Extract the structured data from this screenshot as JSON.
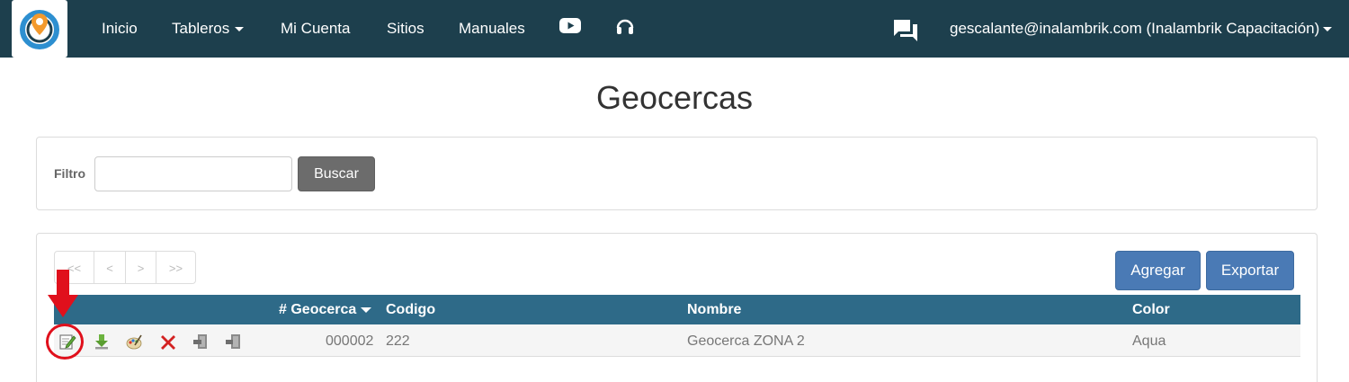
{
  "navbar": {
    "links": {
      "inicio": "Inicio",
      "tableros": "Tableros",
      "mi_cuenta": "Mi Cuenta",
      "sitios": "Sitios",
      "manuales": "Manuales"
    },
    "user": "gescalante@inalambrik.com (Inalambrik Capacitación)",
    "icons": [
      "logo-icon",
      "youtube-icon",
      "headset-icon",
      "chat-icon"
    ],
    "background": "#1d3f4d"
  },
  "page": {
    "title": "Geocercas"
  },
  "filter": {
    "label": "Filtro",
    "value": "",
    "search_label": "Buscar"
  },
  "pager": {
    "first": "<<",
    "prev": "<",
    "next": ">",
    "last": ">>"
  },
  "actions": {
    "add_label": "Agregar",
    "export_label": "Exportar"
  },
  "table": {
    "columns": {
      "id": "# Geocerca",
      "code": "Codigo",
      "name": "Nombre",
      "color": "Color"
    },
    "rows": [
      {
        "id": "000002",
        "code": "222",
        "name": "Geocerca ZONA 2",
        "color": "Aqua",
        "row_actions": [
          "edit-icon",
          "download-icon",
          "palette-icon",
          "delete-icon",
          "assign-icon",
          "unassign-icon"
        ]
      }
    ],
    "header_color": "#2e6a88"
  },
  "annotation": {
    "color": "#e0101c",
    "target": "edit-icon"
  }
}
